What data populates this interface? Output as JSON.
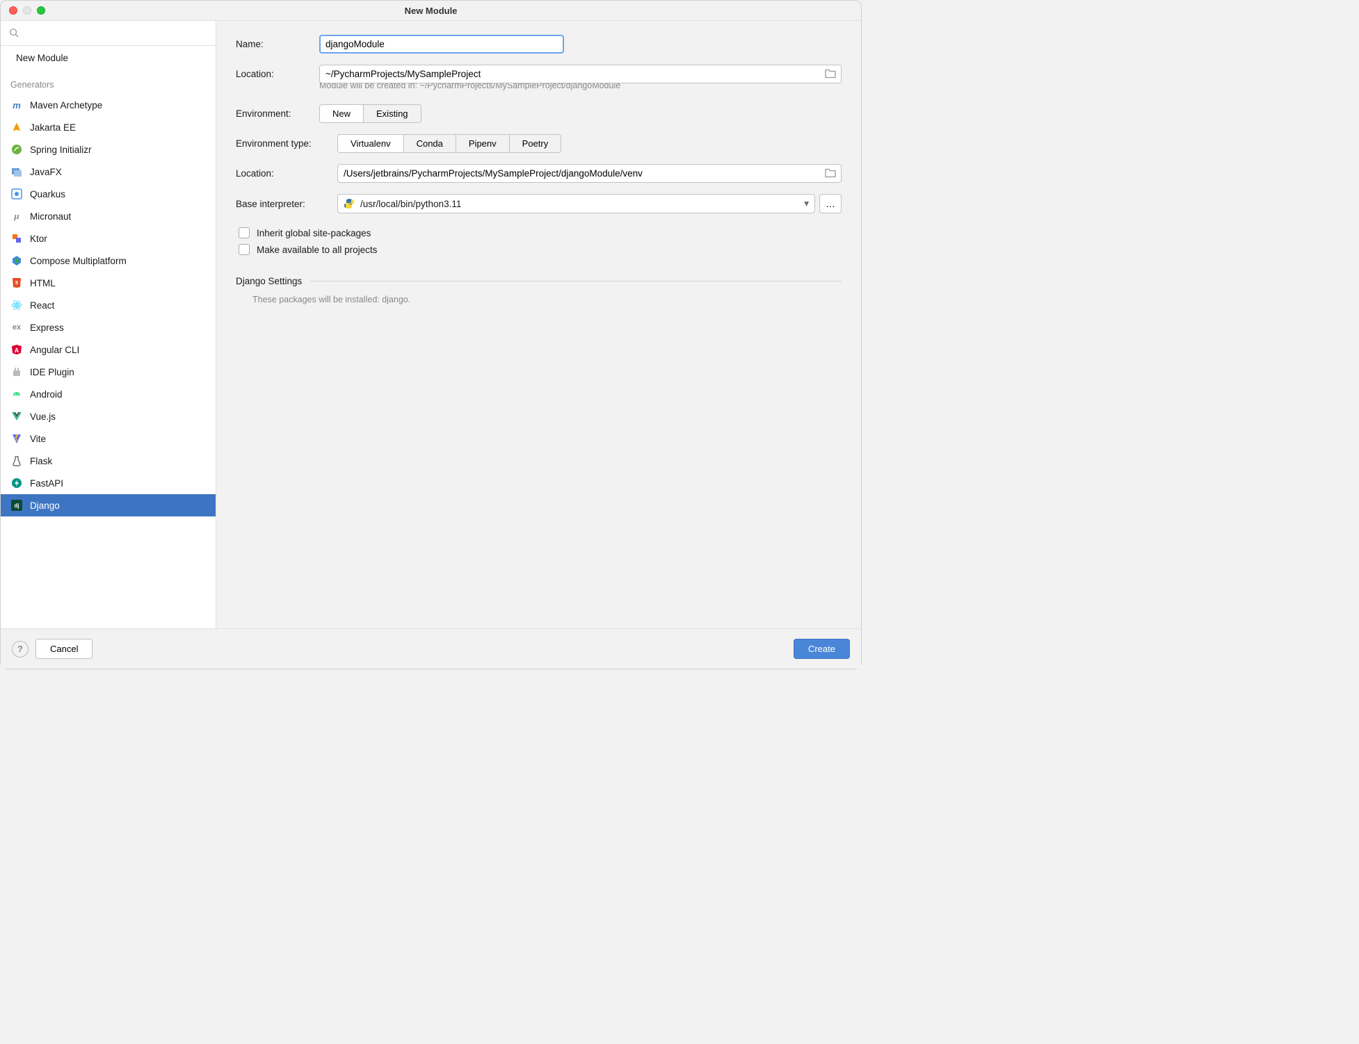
{
  "window": {
    "title": "New Module"
  },
  "search": {
    "placeholder": ""
  },
  "sidebar": {
    "new_module": "New Module",
    "generators_label": "Generators",
    "items": [
      {
        "label": "Maven Archetype"
      },
      {
        "label": "Jakarta EE"
      },
      {
        "label": "Spring Initializr"
      },
      {
        "label": "JavaFX"
      },
      {
        "label": "Quarkus"
      },
      {
        "label": "Micronaut"
      },
      {
        "label": "Ktor"
      },
      {
        "label": "Compose Multiplatform"
      },
      {
        "label": "HTML"
      },
      {
        "label": "React"
      },
      {
        "label": "Express"
      },
      {
        "label": "Angular CLI"
      },
      {
        "label": "IDE Plugin"
      },
      {
        "label": "Android"
      },
      {
        "label": "Vue.js"
      },
      {
        "label": "Vite"
      },
      {
        "label": "Flask"
      },
      {
        "label": "FastAPI"
      },
      {
        "label": "Django"
      }
    ]
  },
  "form": {
    "name_label": "Name:",
    "name_value": "djangoModule",
    "location_label": "Location:",
    "location_value": "~/PycharmProjects/MySampleProject",
    "location_hint": "Module will be created in: ~/PycharmProjects/MySampleProject/djangoModule",
    "env_label": "Environment:",
    "env_options": [
      "New",
      "Existing"
    ],
    "env_selected": "New",
    "env_type_label": "Environment type:",
    "env_type_options": [
      "Virtualenv",
      "Conda",
      "Pipenv",
      "Poetry"
    ],
    "env_type_selected": "Virtualenv",
    "venv_location_label": "Location:",
    "venv_location_value": "/Users/jetbrains/PycharmProjects/MySampleProject/djangoModule/venv",
    "base_interpreter_label": "Base interpreter:",
    "base_interpreter_value": "/usr/local/bin/python3.11",
    "inherit_label": "Inherit global site-packages",
    "available_label": "Make available to all projects",
    "django_section": "Django Settings",
    "packages_hint": "These packages will be installed: django."
  },
  "footer": {
    "cancel": "Cancel",
    "create": "Create"
  }
}
